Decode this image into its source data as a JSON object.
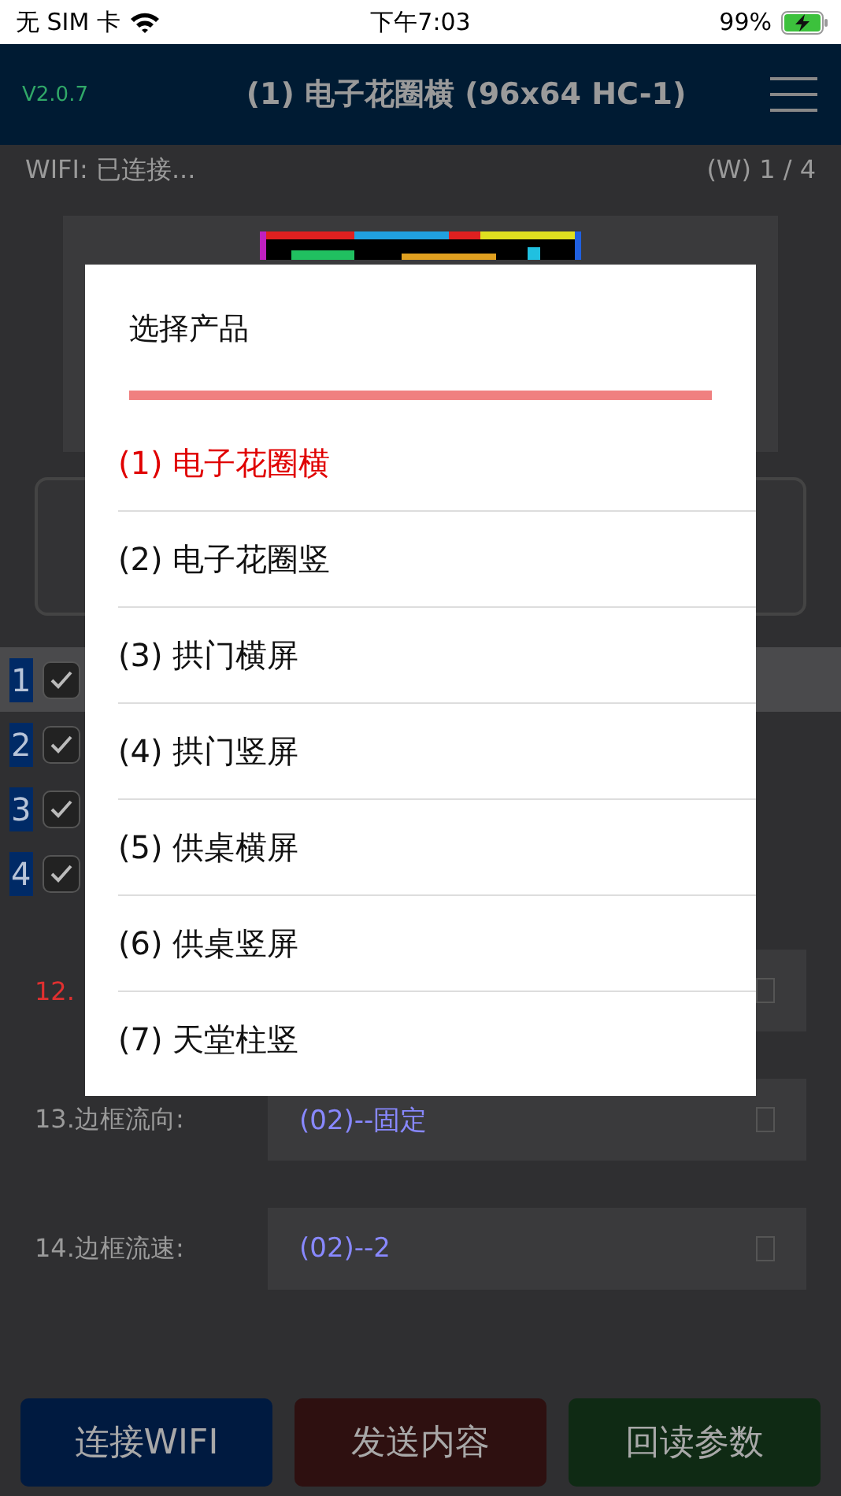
{
  "status_bar": {
    "carrier": "无 SIM 卡",
    "time": "下午7:03",
    "battery": "99%"
  },
  "header": {
    "version": "V2.0.7",
    "title": "(1) 电子花圈横 (96x64 HC-1)"
  },
  "info_bar": {
    "wifi": "WIFI: 已连接...",
    "page": "(W) 1 / 4"
  },
  "lines": [
    {
      "number": "1",
      "checked": true,
      "selected": true
    },
    {
      "number": "2",
      "checked": true,
      "selected": false
    },
    {
      "number": "3",
      "checked": true,
      "selected": false
    },
    {
      "number": "4",
      "checked": true,
      "selected": false
    }
  ],
  "settings": [
    {
      "label": "12.",
      "highlight": true
    },
    {
      "label": "13.边框流向:",
      "value": "(02)--固定",
      "highlight": false
    },
    {
      "label": "14.边框流速:",
      "value": "(02)--2",
      "highlight": false
    }
  ],
  "buttons": [
    {
      "label": "连接WIFI",
      "color": "#001a40"
    },
    {
      "label": "发送内容",
      "color": "#2e1010"
    },
    {
      "label": "回读参数",
      "color": "#0f2a14"
    }
  ],
  "dialog": {
    "title": "选择产品",
    "items": [
      {
        "label": "(1) 电子花圈横",
        "selected": true
      },
      {
        "label": "(2) 电子花圈竖",
        "selected": false
      },
      {
        "label": "(3) 拱门横屏",
        "selected": false
      },
      {
        "label": "(4) 拱门竖屏",
        "selected": false
      },
      {
        "label": "(5) 供桌横屏",
        "selected": false
      },
      {
        "label": "(6) 供桌竖屏",
        "selected": false
      },
      {
        "label": "(7) 天堂柱竖",
        "selected": false
      }
    ]
  }
}
